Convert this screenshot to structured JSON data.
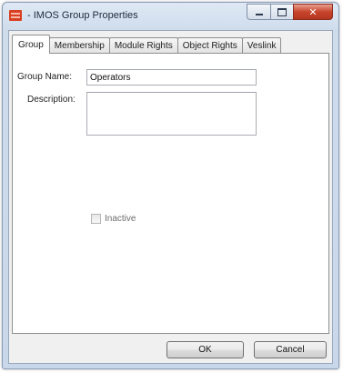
{
  "window": {
    "title": "- IMOS Group Properties",
    "icon": "imos-app-icon",
    "controls": [
      "minimize-icon",
      "maximize-icon",
      "close-icon"
    ],
    "close_glyph": "✕"
  },
  "tabs": [
    {
      "label": "Group",
      "active": true
    },
    {
      "label": "Membership",
      "active": false
    },
    {
      "label": "Module Rights",
      "active": false
    },
    {
      "label": "Object Rights",
      "active": false
    },
    {
      "label": "Veslink",
      "active": false
    }
  ],
  "form": {
    "group_name_label": "Group Name:",
    "group_name_value": "Operators",
    "description_label": "Description:",
    "description_value": "",
    "inactive_label": "Inactive",
    "inactive_checked": false
  },
  "buttons": {
    "ok": "OK",
    "cancel": "Cancel"
  },
  "colors": {
    "title_accent": "#d94023",
    "close_button": "#c8442c"
  }
}
